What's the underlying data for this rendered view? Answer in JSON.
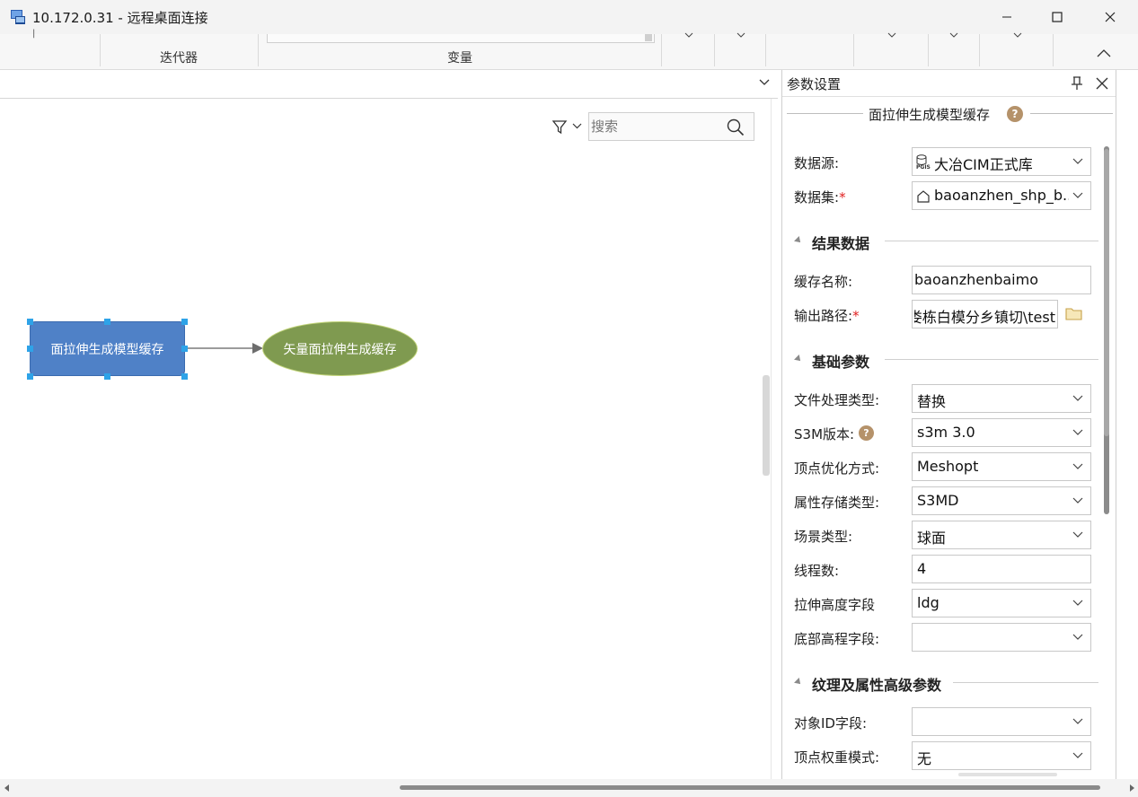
{
  "window": {
    "title": "10.172.0.31 - 远程桌面连接",
    "icons": [
      "remote-desktop-icon",
      "minimize-icon",
      "maximize-icon",
      "close-icon"
    ]
  },
  "ribbon": {
    "groups": [
      {
        "label": "迭代器"
      },
      {
        "label": "变量"
      }
    ]
  },
  "canvas": {
    "search_placeholder": "搜索",
    "nodes": [
      {
        "label": "面拉伸生成模型缓存",
        "shape": "rectangle",
        "fill": "#4f81c7",
        "selected": true
      },
      {
        "label": "矢量面拉伸生成缓存",
        "shape": "ellipse",
        "fill": "#7f9a50",
        "selected": false
      }
    ]
  },
  "panel": {
    "title": "参数设置",
    "tool_title": "面拉伸生成模型缓存",
    "source": {
      "datasource_label": "数据源:",
      "datasource_value": "大冶CIM正式库",
      "datasource_badge": "PGIS",
      "dataset_label": "数据集:",
      "dataset_value": "baoanzhen_shp_b..."
    },
    "sections": {
      "result": "结果数据",
      "basic": "基础参数",
      "advanced": "纹理及属性高级参数"
    },
    "result": {
      "cache_name_label": "缓存名称:",
      "cache_name_value": "baoanzhenbaimo",
      "output_path_label": "输出路径:",
      "output_path_value": "娄栋白模分乡镇切\\test"
    },
    "basic": {
      "file_type_label": "文件处理类型:",
      "file_type_value": "替换",
      "s3m_label": "S3M版本:",
      "s3m_value": "s3m 3.0",
      "vertex_opt_label": "顶点优化方式:",
      "vertex_opt_value": "Meshopt",
      "attr_store_label": "属性存储类型:",
      "attr_store_value": "S3MD",
      "scene_label": "场景类型:",
      "scene_value": "球面",
      "threads_label": "线程数:",
      "threads_value": "4",
      "height_field_label": "拉伸高度字段",
      "height_field_value": "ldg",
      "base_field_label": "底部高程字段:",
      "base_field_value": ""
    },
    "advanced": {
      "object_id_label": "对象ID字段:",
      "object_id_value": "",
      "vertex_weight_label": "顶点权重模式:",
      "vertex_weight_value": "无"
    },
    "required_mark": "*",
    "help_mark": "?"
  }
}
